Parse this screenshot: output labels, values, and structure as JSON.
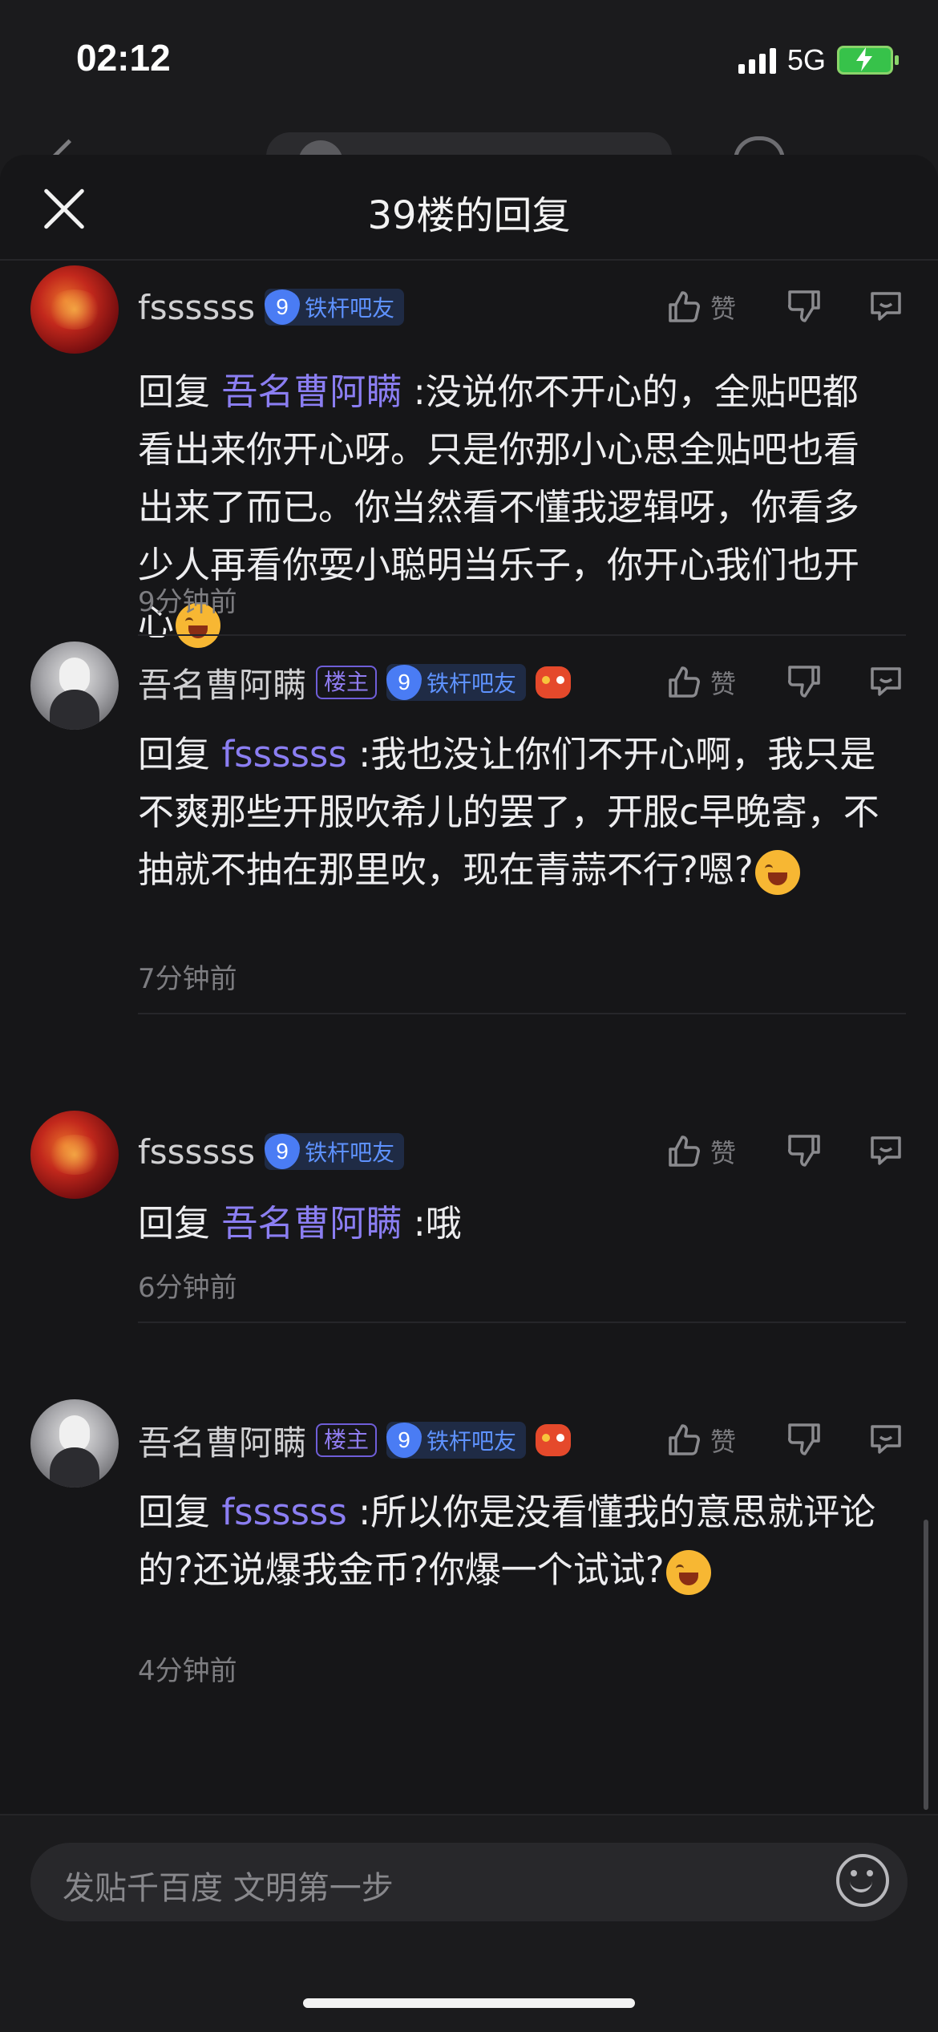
{
  "status": {
    "time": "02:12",
    "network": "5G"
  },
  "sheet": {
    "title": "39楼的回复"
  },
  "comments": [
    {
      "user": "fssssss",
      "owner_badge": "",
      "level": "9",
      "level_label": "铁杆吧友",
      "reply_prefix": "回复 ",
      "mention": "吾名曹阿瞒",
      "text": " :没说你不开心的，全贴吧都看出来你开心呀。只是你那小心思全贴吧也看出来了而已。你当然看不懂我逻辑呀，你看多少人再看你耍小聪明当乐子，你开心我们也开心",
      "time": "9分钟前",
      "like_label": "赞"
    },
    {
      "user": "吾名曹阿瞒",
      "owner_badge": "楼主",
      "level": "9",
      "level_label": "铁杆吧友",
      "reply_prefix": "回复 ",
      "mention": "fssssss",
      "text": " :我也没让你们不开心啊，我只是不爽那些开服吹希儿的罢了，开服c早晚寄，不抽就不抽在那里吹，现在青蒜不行?嗯?",
      "time": "7分钟前",
      "like_label": "赞"
    },
    {
      "user": "fssssss",
      "owner_badge": "",
      "level": "9",
      "level_label": "铁杆吧友",
      "reply_prefix": "回复 ",
      "mention": "吾名曹阿瞒",
      "text": " :哦",
      "time": "6分钟前",
      "like_label": "赞"
    },
    {
      "user": "吾名曹阿瞒",
      "owner_badge": "楼主",
      "level": "9",
      "level_label": "铁杆吧友",
      "reply_prefix": "回复 ",
      "mention": "fssssss",
      "text": " :所以你是没看懂我的意思就评论的?还说爆我金币?你爆一个试试?",
      "time": "4分钟前",
      "like_label": "赞"
    }
  ],
  "input": {
    "placeholder": "发贴千百度 文明第一步"
  },
  "icons": {
    "close": "close-icon",
    "like": "thumbs-up-icon",
    "dislike": "thumbs-down-icon",
    "reply": "reply-bubble-icon",
    "emoji": "emoji-icon",
    "level": "shield-icon",
    "game": "game-controller-icon"
  }
}
